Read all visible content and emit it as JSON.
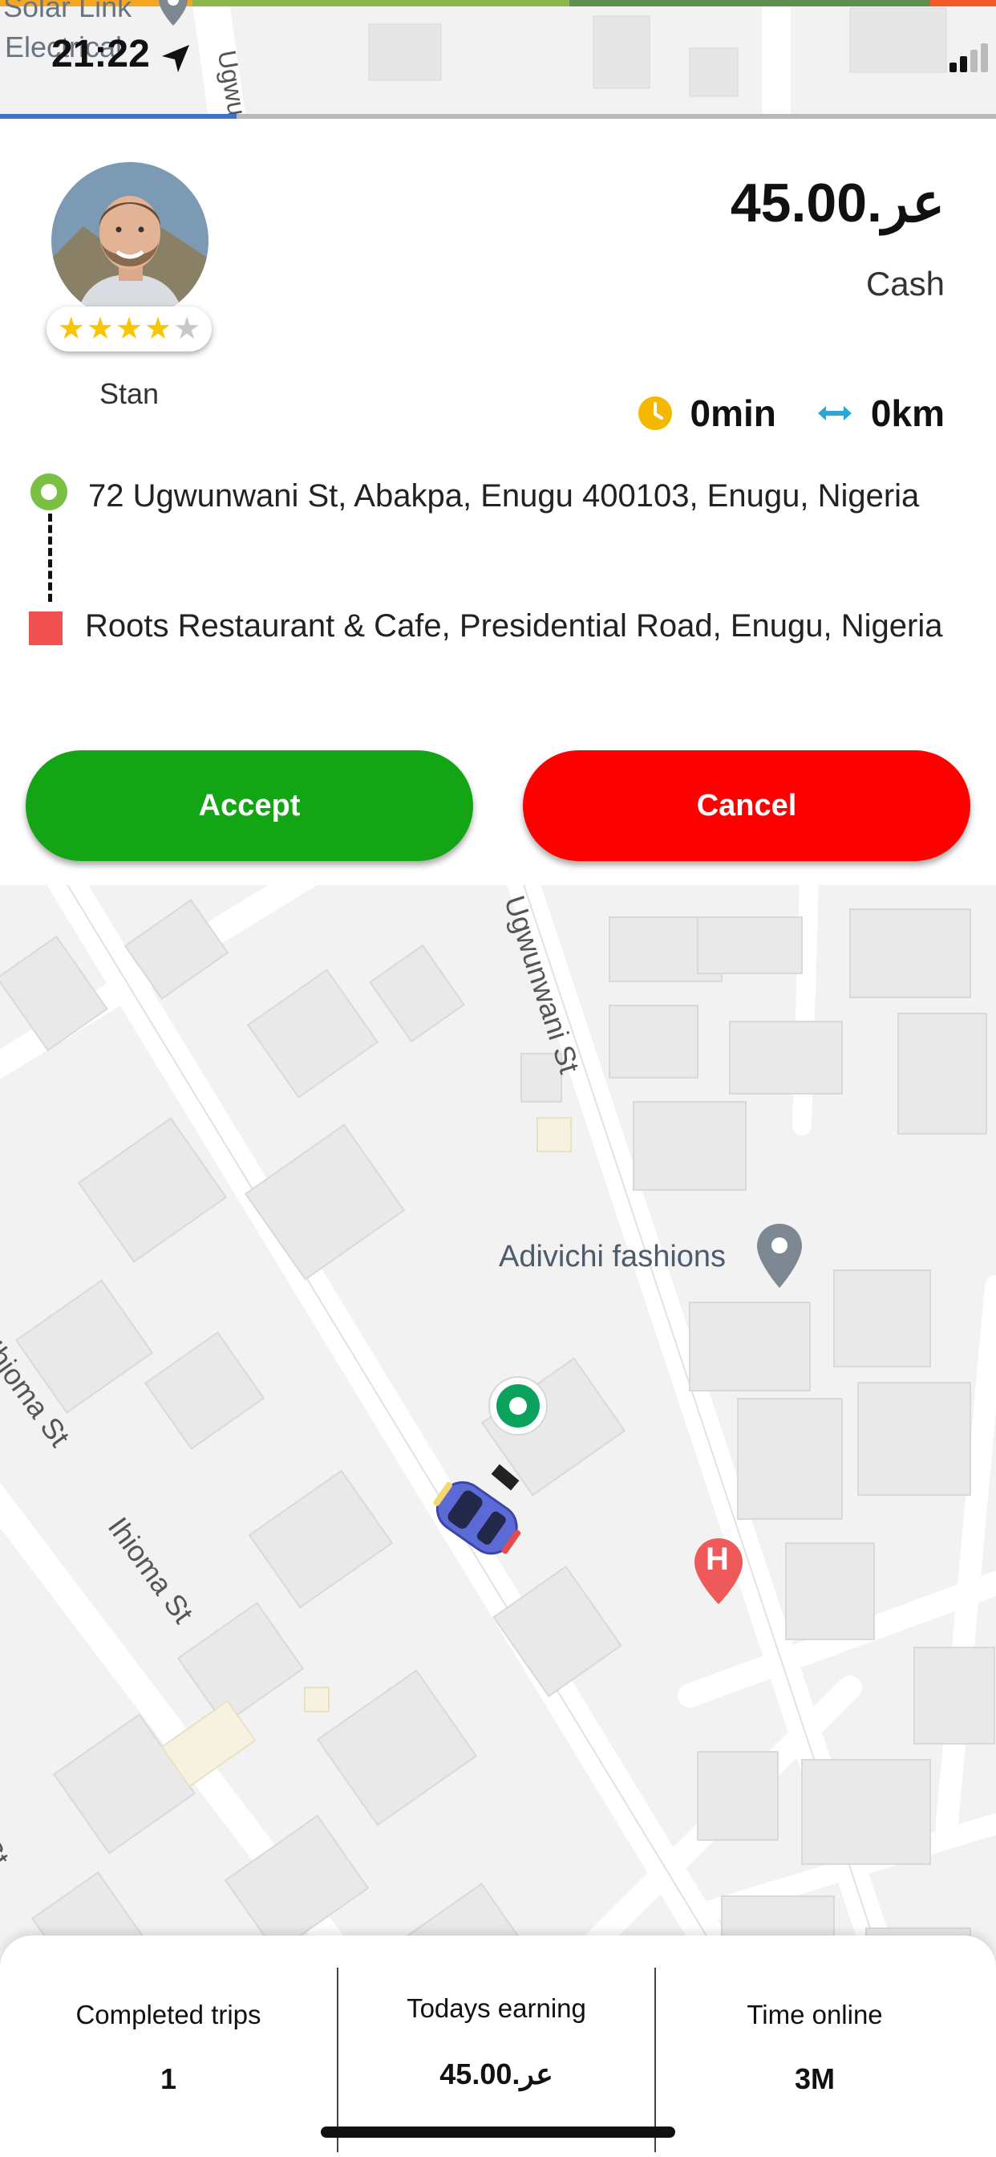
{
  "status_bar": {
    "time": "21:22",
    "map_label_solar": "Solar Link",
    "map_label_electrical": "Electrical",
    "map_label_street": "Ugwunwani St"
  },
  "rider": {
    "name": "Stan",
    "rating_stars": 4,
    "rating_max": 5
  },
  "fare": {
    "amount": "45.00.ﻋﺮ",
    "payment_method": "Cash"
  },
  "trip_metrics": {
    "duration": "0min",
    "distance": "0km"
  },
  "route": {
    "pickup": "72 Ugwunwani St, Abakpa, Enugu 400103, Enugu, Nigeria",
    "dropoff": "Roots Restaurant & Cafe, Presidential Road, Enugu, Nigeria"
  },
  "actions": {
    "accept_label": "Accept",
    "cancel_label": "Cancel"
  },
  "map": {
    "street_ugwunwani": "Ugwunwani St",
    "street_ihioma_1": "Ihioma St",
    "street_ihioma_2": "Ihioma St",
    "street_edge": "St",
    "poi_adivichi": "Adivichi fashions",
    "hospital_marker": "H"
  },
  "stats": {
    "completed_trips_label": "Completed trips",
    "completed_trips_value": "1",
    "todays_earning_label": "Todays earning",
    "todays_earning_value": "45.00.ﻋﺮ",
    "time_online_label": "Time online",
    "time_online_value": "3M"
  },
  "colors": {
    "accept": "#13a515",
    "cancel": "#fd0100",
    "pickup": "#79c043",
    "dropoff": "#f05050",
    "clock": "#f5b800",
    "distance": "#29a8d8"
  }
}
